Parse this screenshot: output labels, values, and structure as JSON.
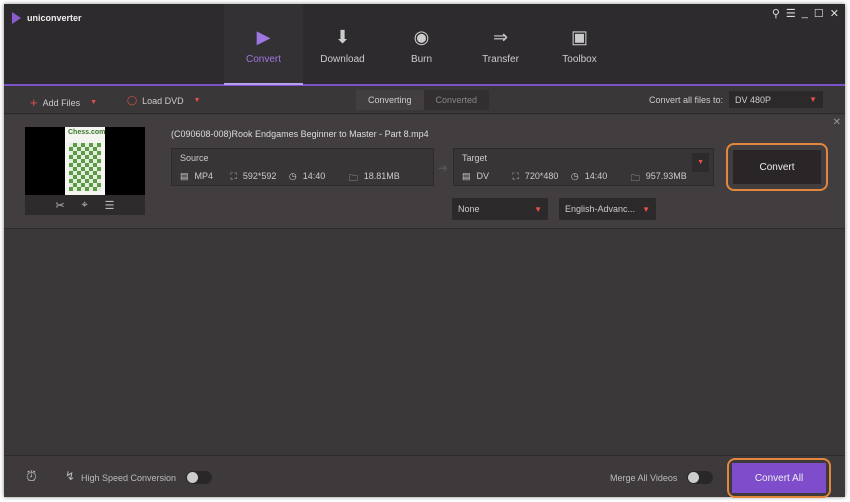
{
  "app": {
    "title": "uniconverter"
  },
  "window_controls": [
    "user-icon",
    "menu-icon",
    "minimize-icon",
    "maximize-icon",
    "close-icon"
  ],
  "nav": [
    {
      "label": "Convert",
      "icon": "convert-icon",
      "active": true
    },
    {
      "label": "Download",
      "icon": "download-icon"
    },
    {
      "label": "Burn",
      "icon": "burn-icon"
    },
    {
      "label": "Transfer",
      "icon": "transfer-icon"
    },
    {
      "label": "Toolbox",
      "icon": "toolbox-icon"
    }
  ],
  "toolbar": {
    "add_files": "Add Files",
    "load_dvd": "Load DVD",
    "tabs": [
      "Converting",
      "Converted"
    ],
    "convert_all_label": "Convert all files to:",
    "convert_all_value": "DV 480P"
  },
  "item": {
    "filename": "(C090608-008)Rook Endgames Beginner to Master - Part 8.mp4",
    "thumb_logo": "Chess.com",
    "source": {
      "label": "Source",
      "format": "MP4",
      "resolution": "592*592",
      "duration": "14:40",
      "size": "18.81MB"
    },
    "target": {
      "label": "Target",
      "format": "DV",
      "resolution": "720*480",
      "duration": "14:40",
      "size": "957.93MB"
    },
    "subtitle": "None",
    "audio": "English-Advanc...",
    "convert": "Convert"
  },
  "bottom": {
    "high_speed": "High Speed Conversion",
    "merge": "Merge All Videos",
    "convert_all": "Convert All"
  },
  "colors": {
    "accent": "#7f4ccc",
    "highlight": "#e2873c"
  }
}
